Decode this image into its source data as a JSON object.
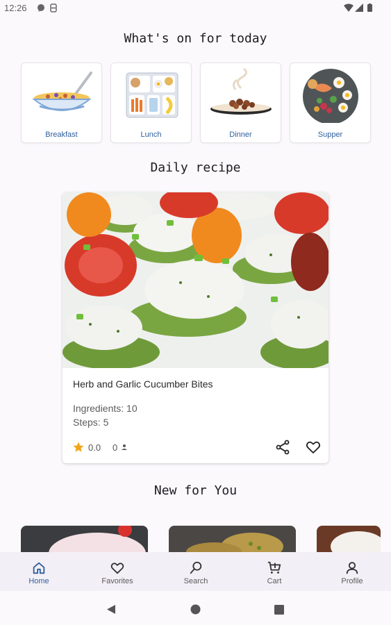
{
  "status_bar": {
    "time": "12:26"
  },
  "sections": {
    "today_title": "What's on for today",
    "daily_title": "Daily recipe",
    "new_title": "New for You"
  },
  "categories": [
    {
      "label": "Breakfast",
      "icon": "cereal-bowl-icon"
    },
    {
      "label": "Lunch",
      "icon": "lunch-box-icon"
    },
    {
      "label": "Dinner",
      "icon": "dinner-plate-icon"
    },
    {
      "label": "Supper",
      "icon": "supper-platter-icon"
    }
  ],
  "daily_recipe": {
    "name": "Herb and Garlic Cucumber Bites",
    "ingredients": "Ingredients: 10",
    "steps": "Steps: 5",
    "rating": "0.0",
    "rating_count": "0",
    "star_color": "#f2a51a"
  },
  "bottom_nav": [
    {
      "label": "Home",
      "icon": "home-icon",
      "active": true
    },
    {
      "label": "Favorites",
      "icon": "heart-icon",
      "active": false
    },
    {
      "label": "Search",
      "icon": "search-icon",
      "active": false
    },
    {
      "label": "Cart",
      "icon": "cart-icon",
      "active": false
    },
    {
      "label": "Profile",
      "icon": "profile-icon",
      "active": false
    }
  ],
  "colors": {
    "accent": "#2e5f9e",
    "nav_bg": "#f3eff6",
    "page_bg": "#fbf9fc"
  }
}
